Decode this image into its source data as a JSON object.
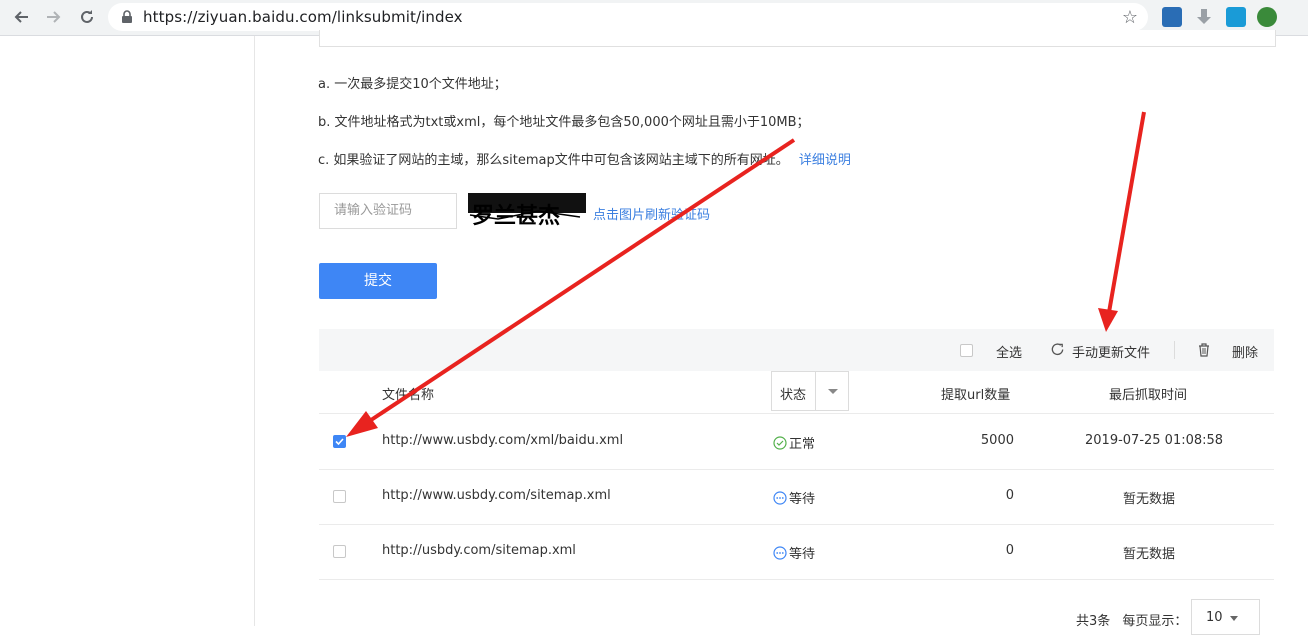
{
  "browser": {
    "url": "https://ziyuan.baidu.com/linksubmit/index"
  },
  "notes": [
    "a. 一次最多提交10个文件地址；",
    "b. 文件地址格式为txt或xml，每个地址文件最多包含50,000个网址且需小于10MB；",
    "c. 如果验证了网站的主域，那么sitemap文件中可包含该网站主域下的所有网址。"
  ],
  "detail_link": "详细说明",
  "captcha": {
    "placeholder": "请输入验证码",
    "refresh_label": "点击图片刷新验证码",
    "image_text": "罗兰甚杰"
  },
  "submit_label": "提交",
  "toolbar": {
    "select_all": "全选",
    "manual_update": "手动更新文件",
    "delete": "删除"
  },
  "table": {
    "headers": {
      "file_name": "文件名称",
      "status": "状态",
      "url_count": "提取url数量",
      "last_crawl": "最后抓取时间"
    },
    "rows": [
      {
        "checked": true,
        "file": "http://www.usbdy.com/xml/baidu.xml",
        "status": "正常",
        "status_type": "ok",
        "count": "5000",
        "time": "2019-07-25 01:08:58"
      },
      {
        "checked": false,
        "file": "http://www.usbdy.com/sitemap.xml",
        "status": "等待",
        "status_type": "waiting",
        "count": "0",
        "time": "暂无数据"
      },
      {
        "checked": false,
        "file": "http://usbdy.com/sitemap.xml",
        "status": "等待",
        "status_type": "waiting",
        "count": "0",
        "time": "暂无数据"
      }
    ]
  },
  "pager": {
    "total": "共3条",
    "per_page_label": "每页显示：",
    "per_page": "10"
  },
  "colors": {
    "accent": "#3e86f5",
    "annotation_arrow": "#e8231f",
    "ok": "#52b04a"
  }
}
